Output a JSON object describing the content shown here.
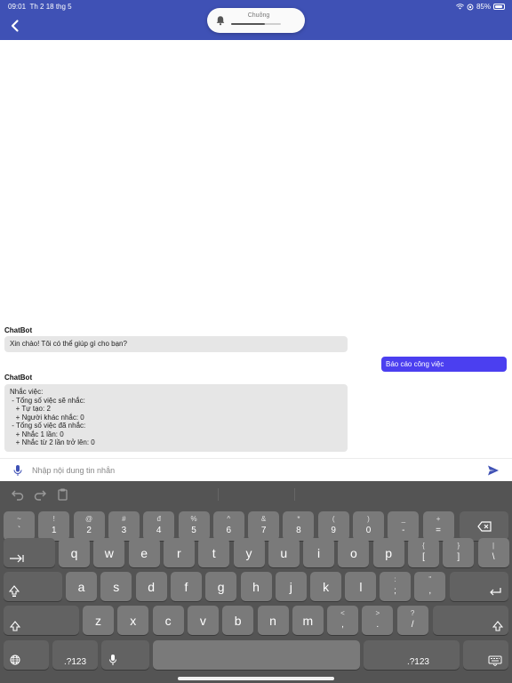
{
  "status_bar": {
    "time": "09:01",
    "date": "Th 2 18 thg 5",
    "battery": "85%"
  },
  "header": {
    "background": "#3f51b5",
    "back_icon": "chevron-left-icon"
  },
  "volume_hud": {
    "label": "Chuông",
    "icon": "bell-icon",
    "level": 0.68
  },
  "chat": {
    "messages": [
      {
        "role": "bot",
        "sender": "ChatBot",
        "text": "Xin chào! Tôi có thể giúp gì cho bạn?"
      },
      {
        "role": "user",
        "text": "Báo cáo công việc",
        "color": "#4b3ff0"
      },
      {
        "role": "bot",
        "sender": "ChatBot",
        "text": "Nhắc việc:\n - Tổng số việc sẽ nhắc:\n   + Tự tạo: 2\n   + Người khác nhắc: 0\n - Tổng số việc đã nhắc:\n   + Nhắc 1 lần: 0\n   + Nhắc từ 2 lần trở lên: 0"
      }
    ]
  },
  "input": {
    "placeholder": "Nhập nội dung tin nhắn",
    "value": "",
    "mic_icon": "microphone-icon",
    "send_icon": "send-icon",
    "send_color": "#3f51b5"
  },
  "keyboard": {
    "toolbar_icons": [
      "undo-icon",
      "redo-icon",
      "clipboard-icon"
    ],
    "row1": [
      {
        "top": "~",
        "bottom": "`"
      },
      {
        "top": "!",
        "bottom": "1"
      },
      {
        "top": "@",
        "bottom": "2"
      },
      {
        "top": "#",
        "bottom": "3"
      },
      {
        "top": "đ",
        "bottom": "4"
      },
      {
        "top": "%",
        "bottom": "5"
      },
      {
        "top": "^",
        "bottom": "6"
      },
      {
        "top": "&",
        "bottom": "7"
      },
      {
        "top": "*",
        "bottom": "8"
      },
      {
        "top": "(",
        "bottom": "9"
      },
      {
        "top": ")",
        "bottom": "0"
      },
      {
        "top": "_",
        "bottom": "-"
      },
      {
        "top": "+",
        "bottom": "="
      }
    ],
    "row2": [
      "q",
      "w",
      "e",
      "r",
      "t",
      "y",
      "u",
      "i",
      "o",
      "p"
    ],
    "row2_symbols": [
      {
        "top": "{",
        "bottom": "["
      },
      {
        "top": "}",
        "bottom": "]"
      },
      {
        "top": "|",
        "bottom": "\\"
      }
    ],
    "row3": [
      "a",
      "s",
      "d",
      "f",
      "g",
      "h",
      "j",
      "k",
      "l"
    ],
    "row3_symbols": [
      {
        "top": ":",
        "bottom": ";"
      },
      {
        "top": "\"",
        "bottom": ","
      }
    ],
    "row4": [
      "z",
      "x",
      "c",
      "v",
      "b",
      "n",
      "m"
    ],
    "row4_symbols": [
      {
        "top": "<",
        "bottom": ","
      },
      {
        "top": ">",
        "bottom": "."
      },
      {
        "top": "?",
        "bottom": "/"
      }
    ],
    "numbers_label": ".?123",
    "numbers_label_right": ".?123",
    "icons": {
      "backspace": "backspace-icon",
      "tab": "tab-icon",
      "caps": "caps-lock-icon",
      "return": "return-icon",
      "shift": "shift-icon",
      "globe": "globe-icon",
      "dictation": "microphone-icon",
      "hide": "keyboard-dismiss-icon"
    }
  }
}
